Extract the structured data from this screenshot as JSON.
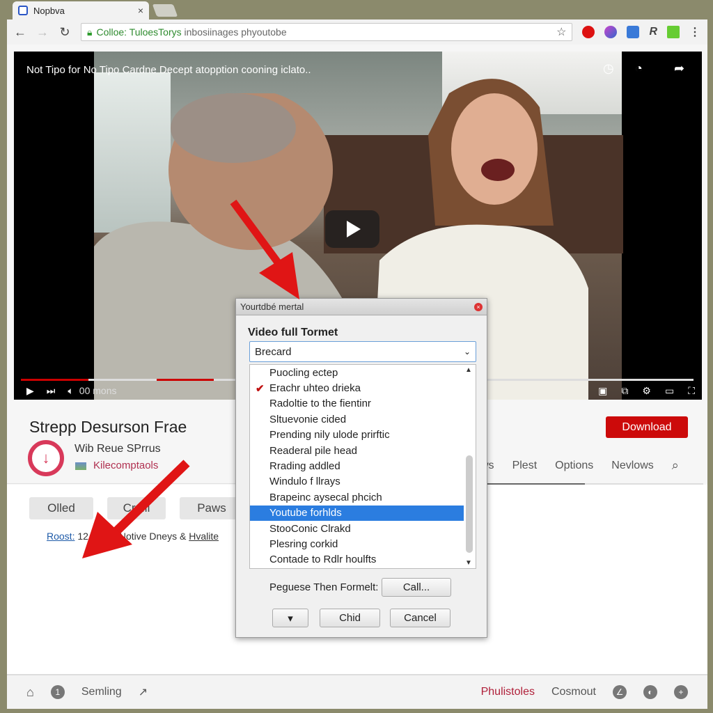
{
  "browser": {
    "tab_title": "Nopbva",
    "tab_close": "×",
    "url_secure": "Colloe: TuloesTorys",
    "url_rest": " inbosiinages phyoutobe",
    "icons": [
      "back-icon",
      "forward-icon",
      "reload-icon",
      "lock-icon",
      "star-icon",
      "extension-icons",
      "menu-icon"
    ]
  },
  "video": {
    "title": "Not Tipo for No Tipo Cardne Decept atopption cooning iclato..",
    "time": "00 mons",
    "progress_played": 0.1,
    "icons": [
      "watch-later-icon",
      "clock-icon",
      "share-icon",
      "play-icon",
      "next-icon",
      "volume-icon",
      "subtitles-icon",
      "miniplayer-icon",
      "settings-icon",
      "theater-icon",
      "fullscreen-icon"
    ]
  },
  "info": {
    "title": "Strepp Desurson Frae",
    "channel_name": "Wib Reue SPrrus",
    "channel_sub": "Kilecomptaols",
    "download_label": "Download",
    "tabs": [
      "ws",
      "Plest",
      "Options",
      "Nevlows"
    ],
    "pills": [
      "Olled",
      "Cr...il",
      "Paws"
    ],
    "meta_link": "Roost:",
    "meta_count": " 12",
    "meta_text": " Notive Dneys & ",
    "meta_underline": "Hvalite"
  },
  "dialog": {
    "title": "Yourtdbé mertal",
    "label": "Video full Tormet",
    "selected_value": "Brecard",
    "options": [
      {
        "label": "Puocling ectep",
        "checked": false,
        "highlighted": false
      },
      {
        "label": "Erachr uhteo drieka",
        "checked": true,
        "highlighted": false
      },
      {
        "label": "Radoltie to the fientinr",
        "checked": false,
        "highlighted": false
      },
      {
        "label": "Sltuevonie cided",
        "checked": false,
        "highlighted": false
      },
      {
        "label": "Prending nily ulode prirftic",
        "checked": false,
        "highlighted": false
      },
      {
        "label": "Readeral pile head",
        "checked": false,
        "highlighted": false
      },
      {
        "label": "Rrading addled",
        "checked": false,
        "highlighted": false
      },
      {
        "label": "Windulo f llrays",
        "checked": false,
        "highlighted": false
      },
      {
        "label": "Brapeinc aysecal phcich",
        "checked": false,
        "highlighted": false
      },
      {
        "label": "Youtube forhlds",
        "checked": false,
        "highlighted": true
      },
      {
        "label": "StooConic Clrakd",
        "checked": false,
        "highlighted": false
      },
      {
        "label": "Plesring corkid",
        "checked": false,
        "highlighted": false
      },
      {
        "label": "Contade to Rdlr houlfts",
        "checked": false,
        "highlighted": false
      }
    ],
    "format_label": "Peguese Then Formelt:",
    "call_button": "Call...",
    "dropdown_button": "▾",
    "child_button": "Chid",
    "cancel_button": "Cancel"
  },
  "bottombar": {
    "left_label": "Semling",
    "red_label": "Phulistoles",
    "right_label": "Cosmout"
  },
  "colors": {
    "accent_red": "#cc0a0a",
    "highlight_blue": "#2b7de0",
    "annotation_arrow": "#e01515"
  }
}
